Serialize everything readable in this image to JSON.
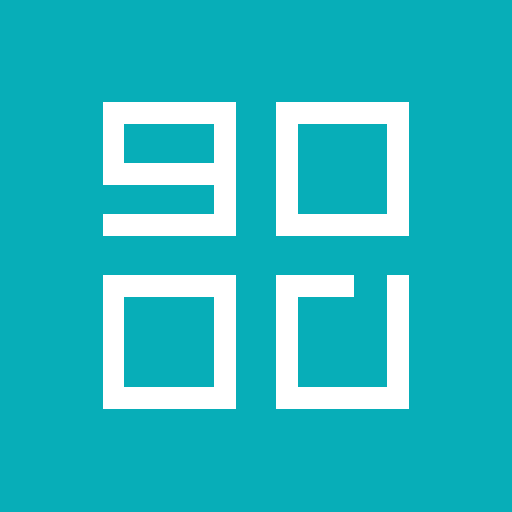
{
  "logo": {
    "name": "good-logo",
    "background_color": "#07aeb8",
    "mark_color": "#ffffff"
  }
}
